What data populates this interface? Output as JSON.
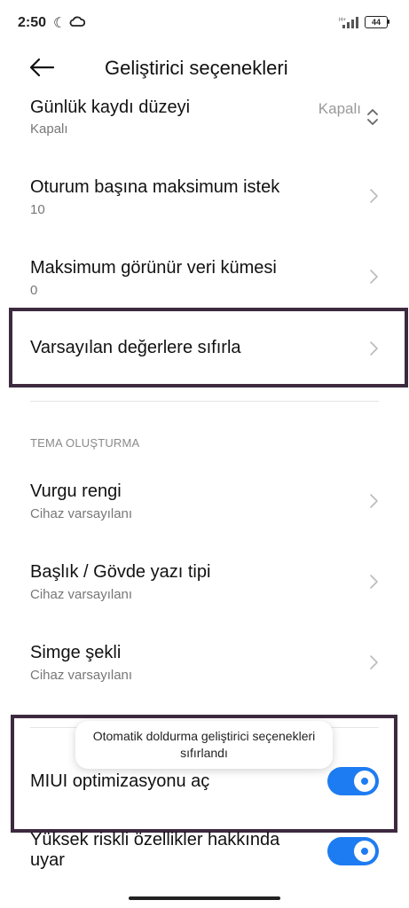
{
  "status_bar": {
    "time": "2:50",
    "battery": "44"
  },
  "header": {
    "title": "Geliştirici seçenekleri"
  },
  "rows": [
    {
      "title": "Günlük kaydı düzeyi",
      "subtitle": "Kapalı",
      "value": "Kapalı"
    },
    {
      "title": "Oturum başına maksimum istek",
      "subtitle": "10"
    },
    {
      "title": "Maksimum görünür veri kümesi",
      "subtitle": "0"
    },
    {
      "title": "Varsayılan değerlere sıfırla"
    }
  ],
  "section": {
    "label": "TEMA OLUŞTURMA"
  },
  "theme_rows": [
    {
      "title": "Vurgu rengi",
      "subtitle": "Cihaz varsayılanı"
    },
    {
      "title": "Başlık / Gövde yazı tipi",
      "subtitle": "Cihaz varsayılanı"
    },
    {
      "title": "Simge şekli",
      "subtitle": "Cihaz varsayılanı"
    }
  ],
  "toggles": [
    {
      "title": "MIUI optimizasyonu aç",
      "on": true
    },
    {
      "title": "Yüksek riskli özellikler hakkında uyar",
      "on": true
    }
  ],
  "toast": {
    "text": "Otomatik doldurma geliştirici seçenekleri sıfırlandı"
  },
  "colors": {
    "accent": "#1e7cf2",
    "highlight": "#3d2a3f"
  }
}
